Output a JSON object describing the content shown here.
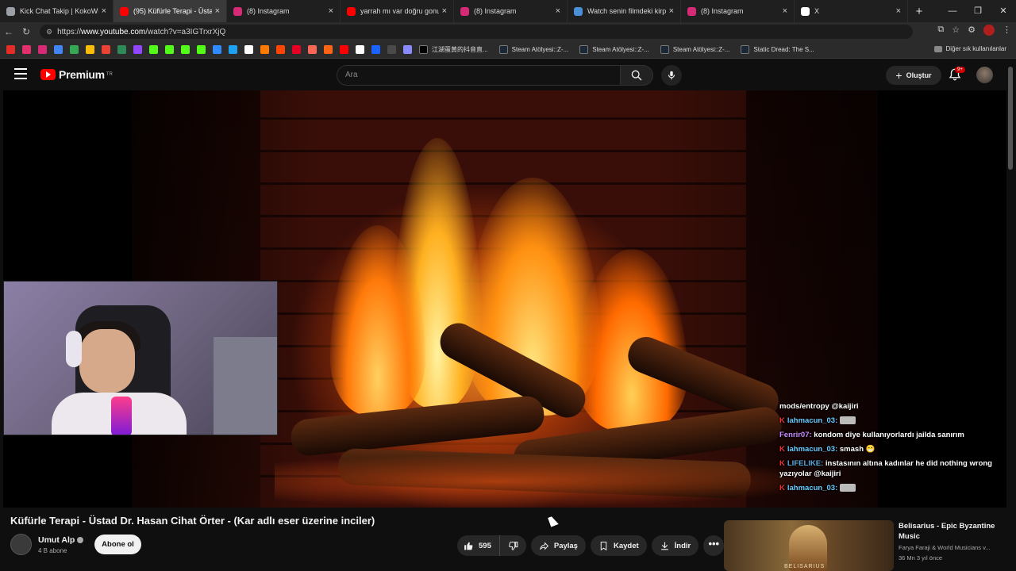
{
  "browser": {
    "tabs": [
      {
        "title": "Kick Chat Takip | KokoWich",
        "icon": "globe-icon",
        "color": "#9aa0a6"
      },
      {
        "title": "(95) Küfürle Terapi - Üstad",
        "icon": "youtube-icon",
        "color": "#ff0000",
        "active": true
      },
      {
        "title": "(8) Instagram",
        "icon": "instagram-icon",
        "color": "#d62976"
      },
      {
        "title": "yarrah mı var doğru gonuşüy",
        "icon": "youtube-icon",
        "color": "#ff0000"
      },
      {
        "title": "(8) Instagram",
        "icon": "instagram-icon",
        "color": "#d62976"
      },
      {
        "title": "Watch senin filmdeki kirpi sal",
        "icon": "globe-icon",
        "color": "#4a90d9"
      },
      {
        "title": "(8) Instagram",
        "icon": "instagram-icon",
        "color": "#d62976"
      },
      {
        "title": "X",
        "icon": "x-icon",
        "color": "#ffffff"
      }
    ],
    "new_tab": "+",
    "window_controls": [
      "—",
      "❐",
      "✕"
    ],
    "url_prefix": "https://",
    "url_domain": "www.youtube.com",
    "url_path": "/watch?v=a3IGTrxrXjQ",
    "bookmark_icons": [
      "#e52d27",
      "#e1306c",
      "#d62976",
      "#4285f4",
      "#34a853",
      "#fbbc05",
      "#ea4335",
      "#2e8b57",
      "#9146ff",
      "#53fc18",
      "#53fc18",
      "#53fc18",
      "#53fc18",
      "#2f8bff",
      "#1da1f2",
      "#ffffff",
      "#ff7a00",
      "#ff4500",
      "#e60023",
      "#f96854",
      "#ff6314",
      "#ff0000",
      "#ffffff",
      "#1b63ff",
      "#4a4a4a",
      "#8a8aff"
    ],
    "bookmarks": [
      {
        "label": "江湖蛋黄的抖音直...",
        "color": "#000000"
      },
      {
        "label": "Steam Atölyesi::Z-...",
        "color": "#1b2838"
      },
      {
        "label": "Steam Atölyesi::Z-...",
        "color": "#1b2838"
      },
      {
        "label": "Steam Atölyesi::Z-...",
        "color": "#1b2838"
      },
      {
        "label": "Static Dread: The S...",
        "color": "#1b2838"
      }
    ],
    "other_bookmarks": "Diğer sık kullanılanlar"
  },
  "youtube": {
    "logo_text": "Premium",
    "region": "TR",
    "search_placeholder": "Ara",
    "create_label": "Oluştur",
    "notification_badge": "9+"
  },
  "chat": [
    {
      "user": "",
      "msg": "mods/entropy @kaijiri",
      "badge": ""
    },
    {
      "user": "lahmacun_03:",
      "msg": "",
      "badge": "K",
      "emote": true
    },
    {
      "user": "Fenrir07:",
      "msg": "kondom diye kullanıyorlardı jailda sanırım",
      "badge": ""
    },
    {
      "user": "lahmacun_03:",
      "msg": "smash 😁",
      "badge": "K"
    },
    {
      "user": "LIFELIKE:",
      "msg": "instasının altına kadınlar he did nothing wrong yazıyolar @kaijiri",
      "badge": "K"
    },
    {
      "user": "lahmacun_03:",
      "msg": "",
      "badge": "K",
      "emote": true
    }
  ],
  "video": {
    "title": "Küfürle Terapi - Üstad Dr. Hasan Cihat Örter - (Kar adlı eser üzerine inciler)",
    "channel": "Umut Alp",
    "subscribers": "4 B abone",
    "subscribe_label": "Abone ol",
    "likes": "595",
    "share_label": "Paylaş",
    "save_label": "Kaydet",
    "download_label": "İndir",
    "more_label": "•••"
  },
  "recommendation": {
    "title": "Belisarius - Epic Byzantine Music",
    "channel": "Farya Faraji & World Musicians v...",
    "meta": "36 Mn  3 yıl önce",
    "thumb_caption": "BELISARIUS"
  }
}
